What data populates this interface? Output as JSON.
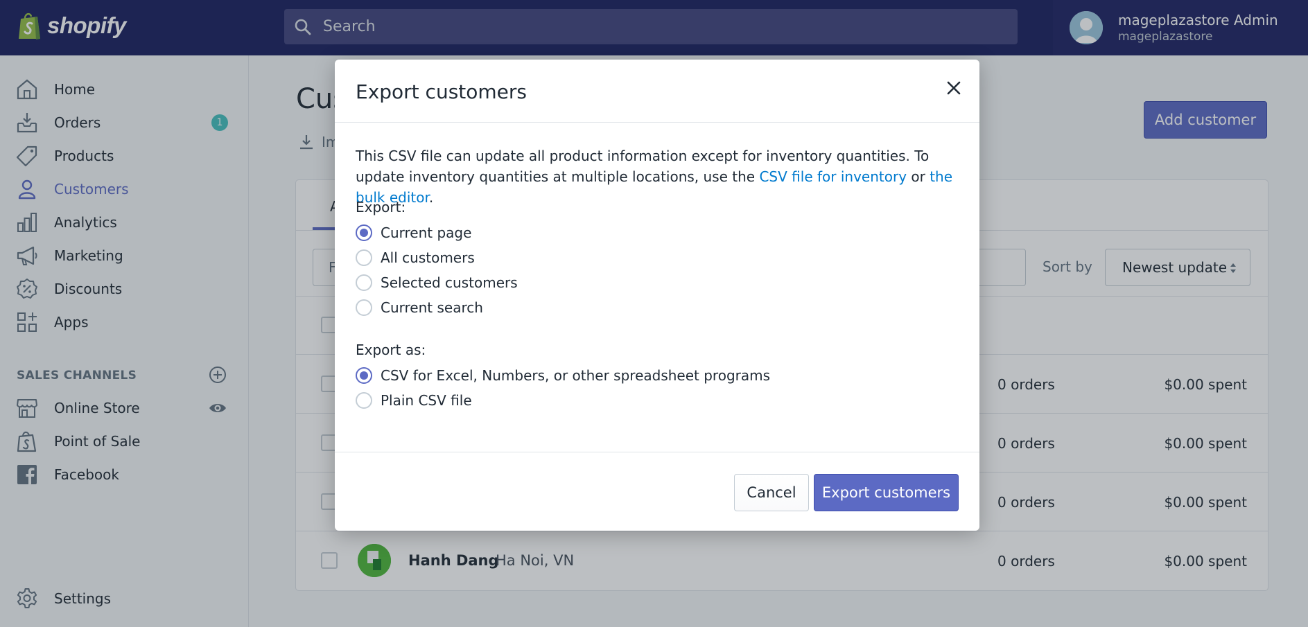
{
  "topbar": {
    "logo_text": "shopify",
    "search_placeholder": "Search",
    "account_name": "mageplazastore Admin",
    "account_store": "mageplazastore"
  },
  "sidebar": {
    "items": [
      {
        "label": "Home",
        "icon": "home-icon"
      },
      {
        "label": "Orders",
        "icon": "orders-icon",
        "badge": "1"
      },
      {
        "label": "Products",
        "icon": "tag-icon"
      },
      {
        "label": "Customers",
        "icon": "person-icon"
      },
      {
        "label": "Analytics",
        "icon": "bar-chart-icon"
      },
      {
        "label": "Marketing",
        "icon": "megaphone-icon"
      },
      {
        "label": "Discounts",
        "icon": "discount-icon"
      },
      {
        "label": "Apps",
        "icon": "apps-icon"
      }
    ],
    "channels_heading": "SALES CHANNELS",
    "channels": [
      {
        "label": "Online Store",
        "icon": "store-icon"
      },
      {
        "label": "Point of Sale",
        "icon": "shopping-bag-icon"
      },
      {
        "label": "Facebook",
        "icon": "facebook-icon"
      }
    ],
    "settings_label": "Settings"
  },
  "main": {
    "title": "Cus",
    "import_label": "Im",
    "add_customer": "Add customer",
    "tab_letter": "A",
    "filter_placeholder": "F",
    "sort_label": "Sort by",
    "sort_value": "Newest update",
    "rows": [
      {
        "orders": "0 orders",
        "spent": "$0.00 spent"
      },
      {
        "orders": "0 orders",
        "spent": "$0.00 spent"
      },
      {
        "orders": "0 orders",
        "spent": "$0.00 spent"
      },
      {
        "name": "Hanh Dang",
        "location": "Ha Noi, VN",
        "orders": "0 orders",
        "spent": "$0.00 spent"
      }
    ]
  },
  "modal": {
    "title": "Export customers",
    "desc_1": "This CSV file can update all product information except for inventory quantities. To update inventory quantities at multiple locations, use the ",
    "desc_link_1": "CSV file for inventory",
    "desc_2": " or ",
    "desc_link_2": "the bulk editor",
    "desc_3": ".",
    "export_label": "Export:",
    "export_options": [
      "Current page",
      "All customers",
      "Selected customers",
      "Current search"
    ],
    "export_selected": "Current page",
    "export_as_label": "Export as:",
    "format_options": [
      "CSV for Excel, Numbers, or other spreadsheet programs",
      "Plain CSV file"
    ],
    "format_selected": "CSV for Excel, Numbers, or other spreadsheet programs",
    "cancel": "Cancel",
    "submit": "Export customers"
  },
  "colors": {
    "topbar": "#1c2260",
    "accent": "#5c6ac4",
    "link": "#007ace",
    "badge": "#47c1bf"
  }
}
